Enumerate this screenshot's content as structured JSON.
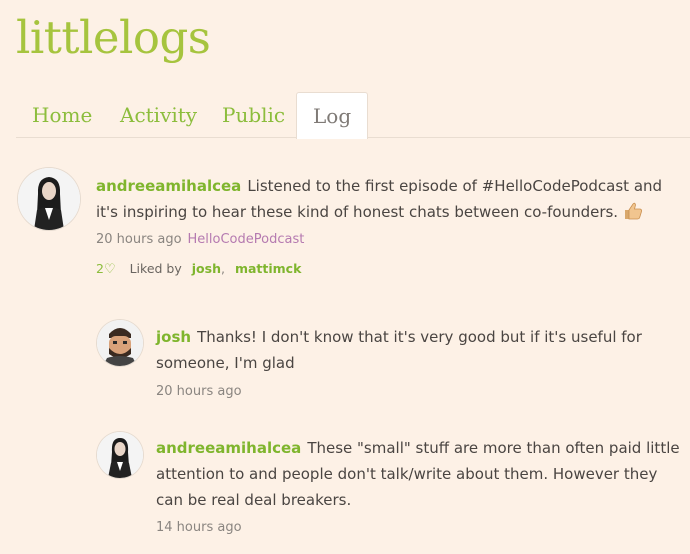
{
  "site": {
    "logo": "littlelogs"
  },
  "nav": {
    "tabs": [
      {
        "label": "Home"
      },
      {
        "label": "Activity"
      },
      {
        "label": "Public"
      },
      {
        "label": "Log",
        "active": true
      }
    ]
  },
  "post": {
    "author": "andreeamihalcea",
    "text_1": "Listened to the first episode of #HelloCodePodcast and",
    "text_2": "it's inspiring to hear these kind of honest chats between co-founders.",
    "emoji": "thumbs-up-icon",
    "time": "20 hours ago",
    "tag": "HelloCodePodcast",
    "like_count": "2",
    "liked_by_label": "Liked by",
    "likers": [
      "josh",
      "mattimck"
    ]
  },
  "replies": [
    {
      "author": "josh",
      "text_1": "Thanks! I don't know that it's very good but if it's useful for",
      "text_2": "someone, I'm glad",
      "time": "20 hours ago"
    },
    {
      "author": "andreeamihalcea",
      "text_1": "These \"small\" stuff are more than often paid little",
      "text_2": "attention to and people don't talk/write about them. However they",
      "text_3": "can be real deal breakers.",
      "time": "14 hours ago"
    }
  ],
  "colors": {
    "background": "#fdf1e6",
    "brand_green": "#a6c43e",
    "link_green": "#7fb52d",
    "tag_purple": "#b57ab0"
  }
}
